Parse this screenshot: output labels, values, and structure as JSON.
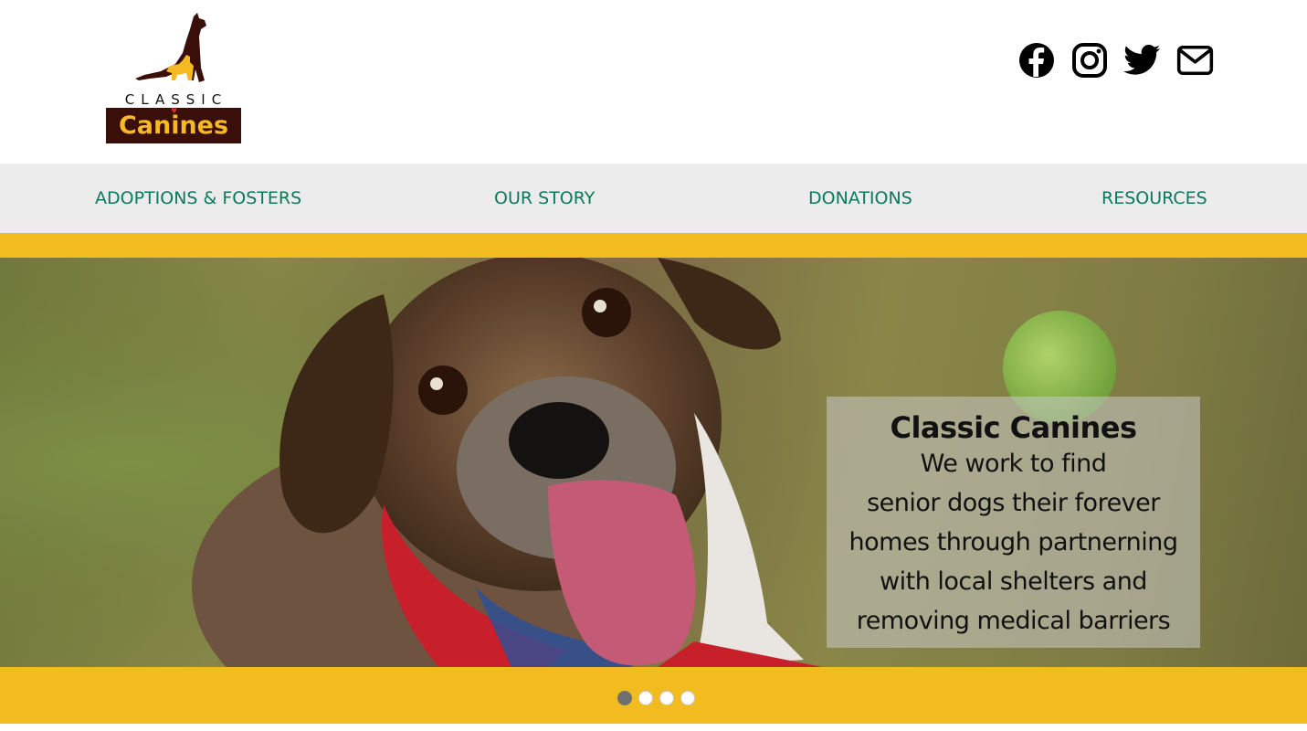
{
  "logo": {
    "classic_text": "CLASSIC",
    "canines_text": "Canines"
  },
  "social": [
    {
      "name": "facebook",
      "icon": "facebook-icon"
    },
    {
      "name": "instagram",
      "icon": "instagram-icon"
    },
    {
      "name": "twitter",
      "icon": "twitter-icon"
    },
    {
      "name": "email",
      "icon": "mail-icon"
    }
  ],
  "nav": {
    "items": [
      {
        "label": "ADOPTIONS & FOSTERS"
      },
      {
        "label": "OUR STORY"
      },
      {
        "label": "DONATIONS"
      },
      {
        "label": "RESOURCES"
      }
    ]
  },
  "hero": {
    "title": "Classic Canines",
    "lines": [
      "We work to find",
      "senior dogs their forever",
      "homes through partnerning",
      "with local shelters and",
      "removing medical barriers"
    ]
  },
  "slider": {
    "slide_count": 4,
    "active_index": 0
  },
  "colors": {
    "accent_yellow": "#f2bb20",
    "nav_text": "#0a7a5c",
    "nav_bg": "#ececec",
    "logo_brown": "#3a0f0a"
  }
}
